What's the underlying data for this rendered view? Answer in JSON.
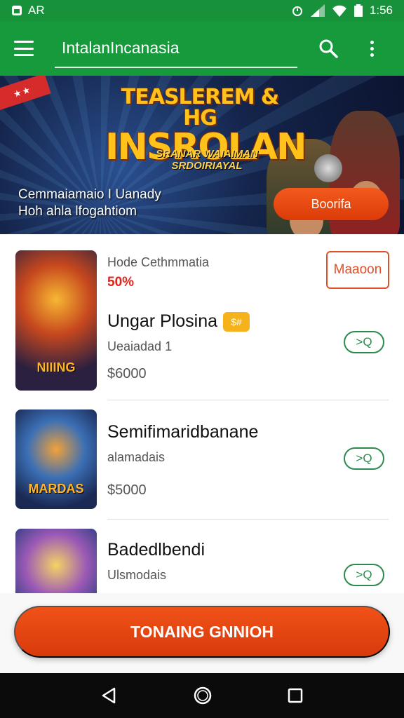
{
  "status_bar": {
    "left_text": "AR",
    "time": "1:56"
  },
  "app_bar": {
    "title": "IntalanIncanasia"
  },
  "banner": {
    "headline_line1": "TEASLEREM & HG",
    "headline_line2": "INSROLAN",
    "subhead": "SRANAR WAIAIMAN SRDOIRIAYAL",
    "caption_line1": "Cemmaiamaio I Uanady",
    "caption_line2": "Hoh ahla lfogahtiom",
    "cta_label": "Boorifa"
  },
  "list": {
    "items": [
      {
        "subtitle": "Hode Cethmmatia",
        "discount": "50%",
        "title": "Ungar Plosina",
        "badge": "$#",
        "meta": "Ueaiadad 1",
        "price": "$6000",
        "action_label": "Maaoon",
        "pill_label": ">Q",
        "thumb_label": "NIIING"
      },
      {
        "title": "Semifimaridbanane",
        "meta": "alamadais",
        "price": "$5000",
        "pill_label": ">Q",
        "thumb_label": "MARDAS"
      },
      {
        "title": "Badedlbendi",
        "meta": "Ulsmodais",
        "pill_label": ">Q"
      }
    ]
  },
  "bottom_cta": {
    "label": "TONAING GNNIOH"
  },
  "colors": {
    "primary_green": "#169a3c",
    "accent_orange": "#e8470f",
    "pill_green": "#2d8a4f",
    "discount_red": "#e0231b"
  }
}
